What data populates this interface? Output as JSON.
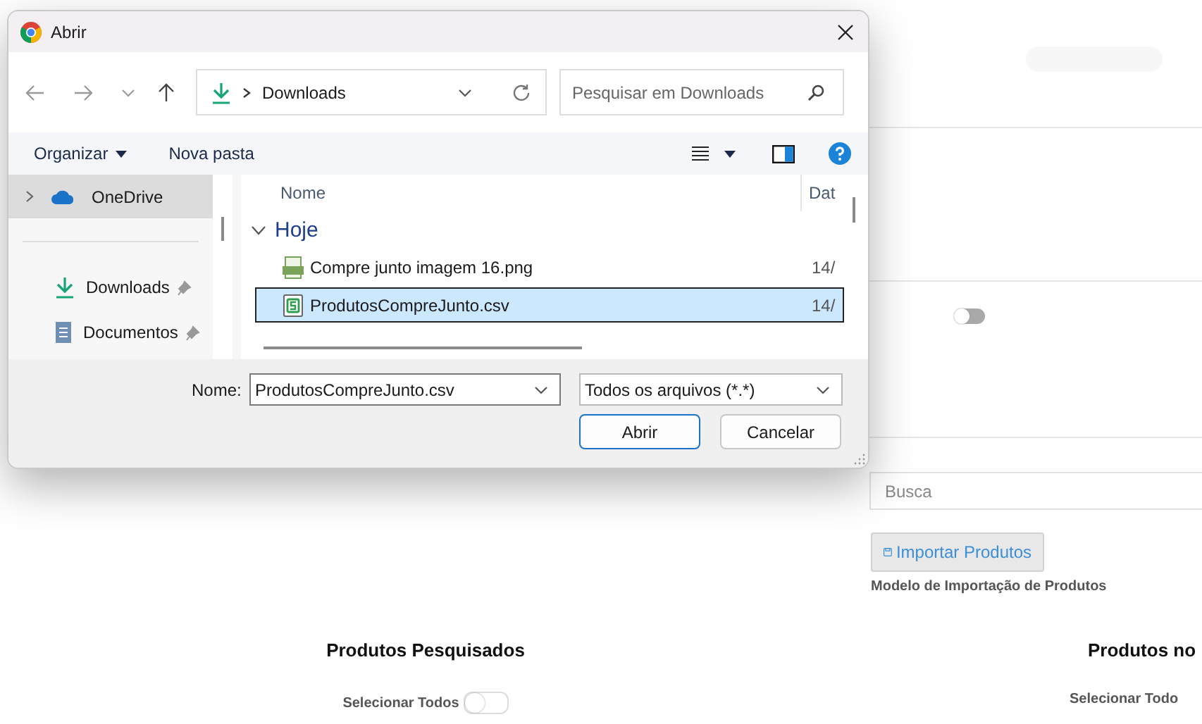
{
  "page": {
    "toggle": {
      "on": false
    },
    "search": {
      "placeholder": "Busca"
    },
    "import_button": "Importar Produtos",
    "template_link": "Modelo de Importação de Produtos",
    "panels": [
      {
        "title": "Produtos Pesquisados",
        "select_all": "Selecionar Todos",
        "select_all_on": false
      },
      {
        "title": "Produtos no",
        "select_all": "Selecionar Todo"
      }
    ]
  },
  "dialog": {
    "title": "Abrir",
    "address": {
      "folder": "Downloads"
    },
    "search": {
      "placeholder": "Pesquisar em Downloads"
    },
    "toolbar": {
      "organize": "Organizar",
      "new_folder": "Nova pasta"
    },
    "nav_pane": [
      {
        "label": "OneDrive",
        "kind": "cloud",
        "selected": true,
        "pinned": false
      },
      {
        "label": "Downloads",
        "kind": "download",
        "selected": false,
        "pinned": true
      },
      {
        "label": "Documentos",
        "kind": "document",
        "selected": false,
        "pinned": true
      }
    ],
    "columns": [
      "Nome",
      "Dat"
    ],
    "group": {
      "label": "Hoje",
      "expanded": true
    },
    "files": [
      {
        "name": "Compre junto imagem 16.png",
        "date": "14/",
        "kind": "image",
        "selected": false
      },
      {
        "name": "ProdutosCompreJunto.csv",
        "date": "14/",
        "kind": "spreadsheet",
        "selected": true
      }
    ],
    "filename_label": "Nome:",
    "filename": "ProdutosCompreJunto.csv",
    "filetype": "Todos os arquivos (*.*)",
    "buttons": [
      {
        "label": "Abrir",
        "primary": true
      },
      {
        "label": "Cancelar",
        "primary": false
      }
    ]
  }
}
